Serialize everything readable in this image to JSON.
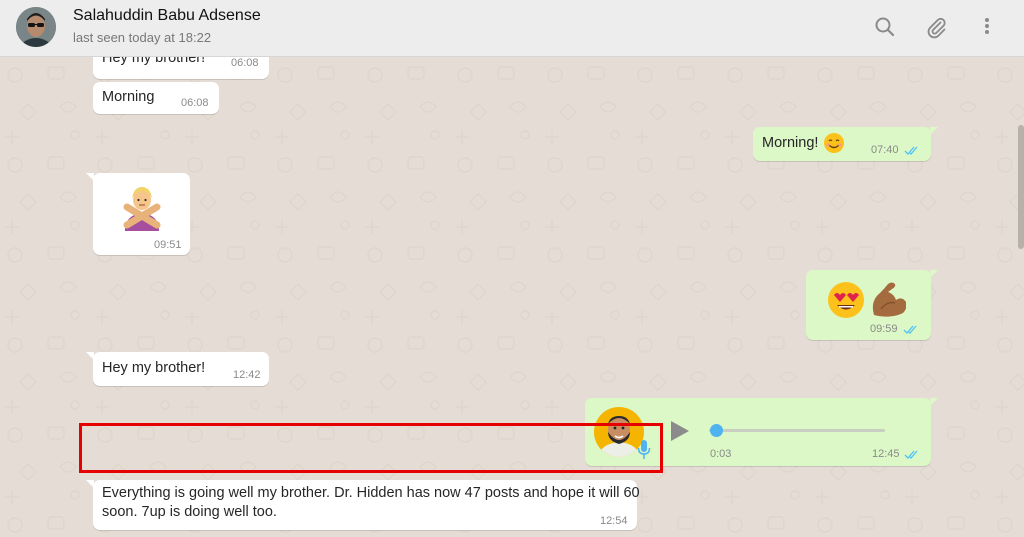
{
  "header": {
    "contact_name": "Salahuddin Babu Adsense",
    "status": "last seen today at 18:22",
    "icons": [
      "search-icon",
      "attach-icon",
      "menu-icon"
    ]
  },
  "messages": [
    {
      "direction": "in",
      "text": "Hey my brother!",
      "time": "06:08"
    },
    {
      "direction": "in",
      "text": "Morning",
      "time": "06:08"
    },
    {
      "direction": "out",
      "text": "Morning!",
      "emoji": "smiling-face-emoji",
      "time": "07:40",
      "status": "read"
    },
    {
      "direction": "in",
      "emoji": "person-gesturing-no-emoji",
      "time": "09:51"
    },
    {
      "direction": "out",
      "emoji": "heart-eyes-and-flexed-biceps-emoji",
      "time": "09:59",
      "status": "read"
    },
    {
      "direction": "in",
      "text": "Hey my brother!",
      "time": "12:42"
    },
    {
      "direction": "out",
      "type": "voice",
      "duration": "0:03",
      "time": "12:45",
      "status": "read"
    },
    {
      "direction": "in",
      "text_line1": "Everything is going well my brother. Dr. Hidden has now 47 posts and hope it will 60",
      "text_line2": "soon. 7up is doing well too.",
      "time": "12:54",
      "highlighted": true
    }
  ],
  "colors": {
    "chat_bg": "#e5ddd5",
    "incoming": "#ffffff",
    "outgoing": "#dcf8c6",
    "read_ticks": "#4fc3f7",
    "highlight_border": "#e60000"
  }
}
